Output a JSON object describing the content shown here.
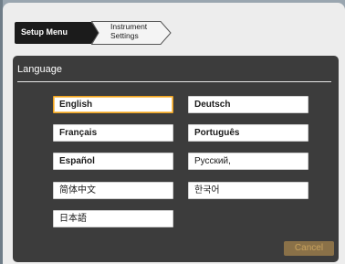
{
  "breadcrumb": {
    "items": [
      {
        "label": "Setup Menu"
      },
      {
        "label_line1": "Instrument",
        "label_line2": "Settings"
      }
    ]
  },
  "panel": {
    "title": "Language"
  },
  "languages": [
    {
      "label": "English",
      "selected": true
    },
    {
      "label": "Deutsch",
      "selected": false
    },
    {
      "label": "Français",
      "selected": false
    },
    {
      "label": "Português",
      "selected": false
    },
    {
      "label": "Español",
      "selected": false
    },
    {
      "label": "Русский,",
      "selected": false
    },
    {
      "label": "简体中文",
      "selected": false
    },
    {
      "label": "한국어",
      "selected": false
    },
    {
      "label": "日本語",
      "selected": false
    }
  ],
  "actions": {
    "cancel_label": "Cancel"
  },
  "colors": {
    "accent_selected": "#f0a21c",
    "panel_bg": "#3c3c3c",
    "cancel_bg": "#8a7148",
    "cancel_text": "#c9a35e"
  }
}
